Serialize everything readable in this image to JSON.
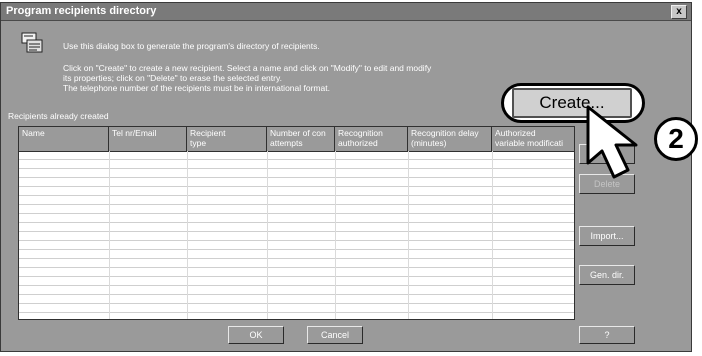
{
  "window": {
    "title": "Program recipients directory",
    "close_label": "x"
  },
  "instructions": {
    "line1": "Use this dialog box to generate the program's directory of recipients.",
    "line2": "Click on  \"Create\" to create a new recipient. Select a name and click on  \"Modify\" to edit and modify",
    "line3": "its properties; click on  \"Delete\" to erase the selected entry.",
    "line4": "The telephone number of the recipients must be in international format."
  },
  "list": {
    "label": "Recipients already created",
    "columns": [
      "Name",
      "Tel nr/Email",
      "Recipient\ntype",
      "Number of con\nattempts",
      "Recognition\nauthorized",
      "Recognition delay\n(minutes)",
      "Authorized\nvariable modificati"
    ],
    "rows": []
  },
  "buttons": {
    "create": "Create...",
    "modify": "Mo",
    "delete": "Delete",
    "import": "Import...",
    "gen_dir": "Gen. dir.",
    "ok": "OK",
    "cancel": "Cancel",
    "help": "?"
  },
  "callout": {
    "number": "2"
  }
}
